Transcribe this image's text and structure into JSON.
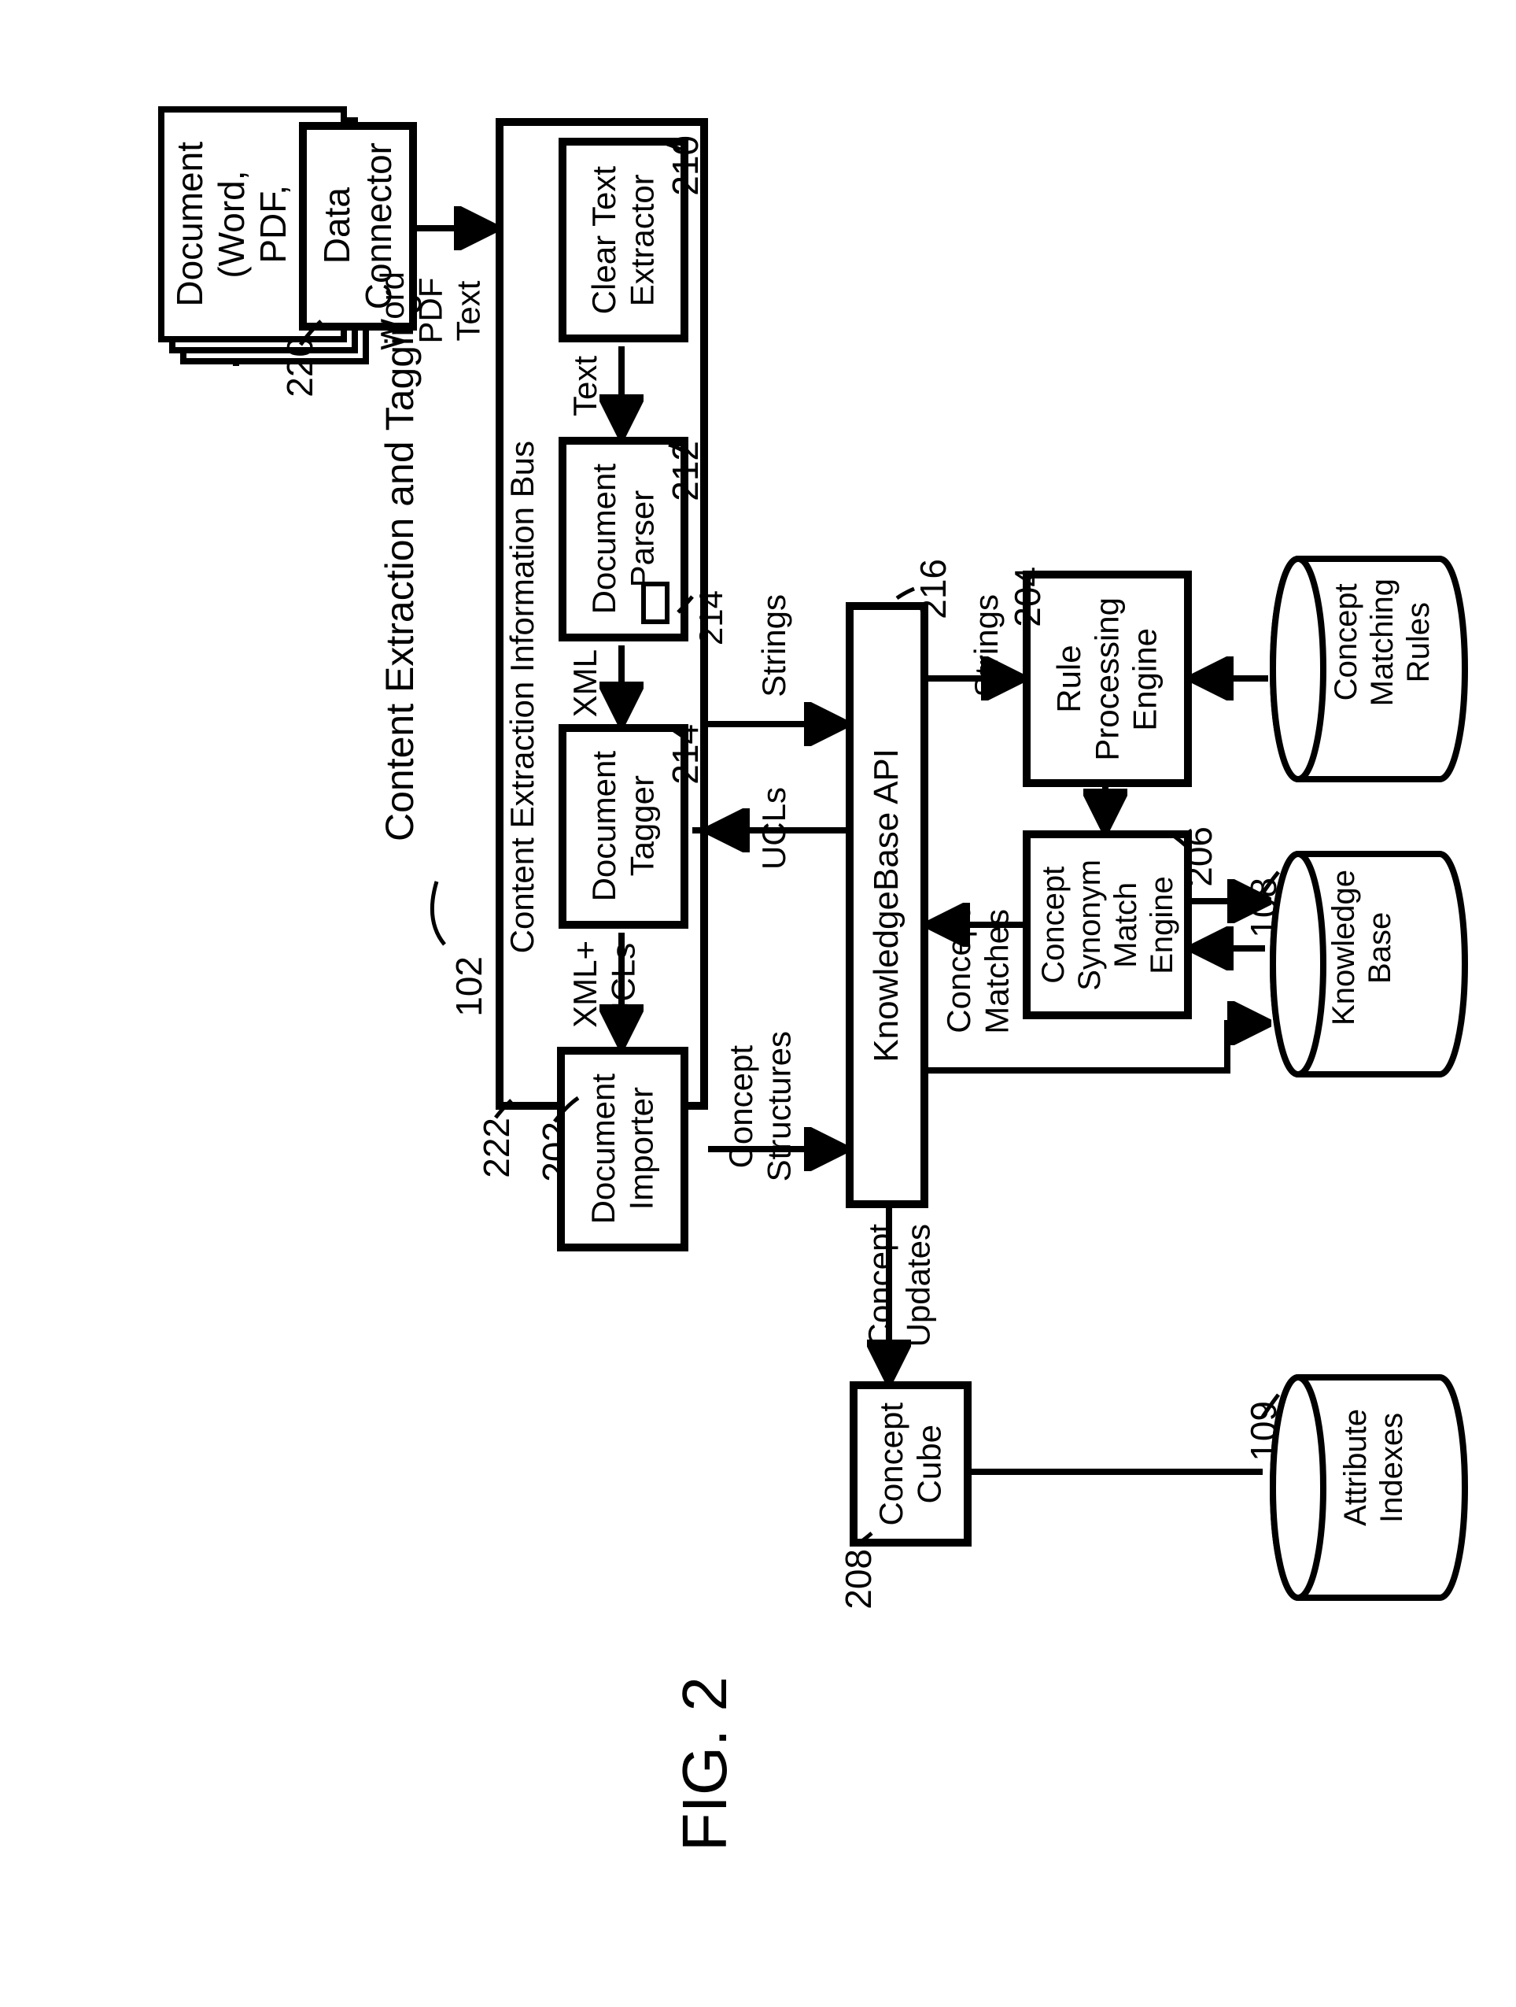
{
  "title": "Content Extraction and Tagging Service",
  "figure": "FIG. 2",
  "refs": {
    "system": "102",
    "dataConnector": "220",
    "bus": "222",
    "busInner": "202",
    "clearText": "210",
    "parser": "212",
    "parserInset": "214",
    "tagger": "214",
    "api": "216",
    "rule": "204",
    "synonym": "206",
    "cube": "208",
    "kb": "108",
    "attr": "109"
  },
  "blocks": {
    "document": "Document\n(Word,\nPDF,\nText)",
    "dataConnector": "Data\nConnector",
    "busTitle": "Content Extraction Information Bus",
    "clearText": "Clear Text\nExtractor",
    "parser": "Document\nParser",
    "tagger": "Document\nTagger",
    "importer": "Document\nImporter",
    "api": "KnowledgeBase API",
    "rule": "Rule\nProcessing\nEngine",
    "synonym": "Concept\nSynonym\nMatch\nEngine",
    "cube": "Concept\nCube",
    "kb": "Knowledge\nBase",
    "rulesDb": "Concept\nMatching\nRules",
    "attrDb": "Attribute\nIndexes"
  },
  "flows": {
    "wordPdfText": "Word\nPDF\nText",
    "text": "Text",
    "xml": "XML",
    "xmlUcls": "XML+\nUCLs",
    "strings1": "Strings",
    "ucls": "UCLs",
    "conceptStructures": "Concept\nStructures",
    "strings2": "Strings",
    "conceptMatches": "Concept\nMatches",
    "conceptUpdates": "Concept\nUpdates"
  }
}
